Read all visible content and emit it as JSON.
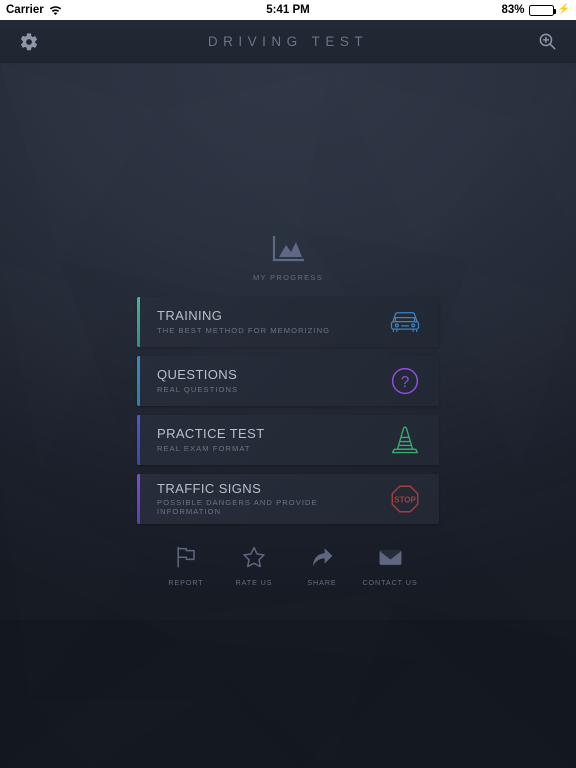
{
  "statusbar": {
    "carrier": "Carrier",
    "wifi_icon": "wifi-icon",
    "time": "5:41 PM",
    "battery_percent": "83%",
    "battery_level": 83,
    "charging_icon": "lightning-bolt-icon"
  },
  "navbar": {
    "title": "DRIVING TEST",
    "settings_icon": "gear-icon",
    "search_icon": "search-zoom-in-icon"
  },
  "progress": {
    "label": "MY PROGRESS",
    "icon": "area-chart-icon"
  },
  "cards": [
    {
      "title": "TRAINING",
      "subtitle": "THE BEST METHOD FOR MEMORIZING",
      "icon": "car-front-icon",
      "icon_color": "#3a7fb5",
      "accent_color": "#3aa08c"
    },
    {
      "title": "QUESTIONS",
      "subtitle": "REAL QUESTIONS",
      "icon": "question-mark-circle-icon",
      "icon_color": "#8b4fd8",
      "accent_color": "#3a7bb5"
    },
    {
      "title": "PRACTICE TEST",
      "subtitle": "REAL EXAM FORMAT",
      "icon": "traffic-cone-icon",
      "icon_color": "#35a06a",
      "accent_color": "#4a55b5"
    },
    {
      "title": "TRAFFIC SIGNS",
      "subtitle": "POSSIBLE DANGERS AND PROVIDE INFORMATION",
      "icon": "stop-sign-icon",
      "icon_label": "STOP",
      "icon_color": "#a33a3a",
      "accent_color": "#6b46c1"
    }
  ],
  "footer": [
    {
      "label": "REPORT",
      "icon": "flag-icon"
    },
    {
      "label": "RATE US",
      "icon": "star-outline-icon"
    },
    {
      "label": "SHARE",
      "icon": "share-arrow-icon"
    },
    {
      "label": "CONTACT US",
      "icon": "envelope-icon"
    }
  ],
  "theme": {
    "background_top": "#2f3746",
    "background_bottom": "#161b24",
    "navbar_bg": "#212733",
    "card_bg": "#262c39",
    "title_text": "#b9bfcd",
    "sub_text": "#6d7486",
    "muted_text": "#646c7e"
  }
}
